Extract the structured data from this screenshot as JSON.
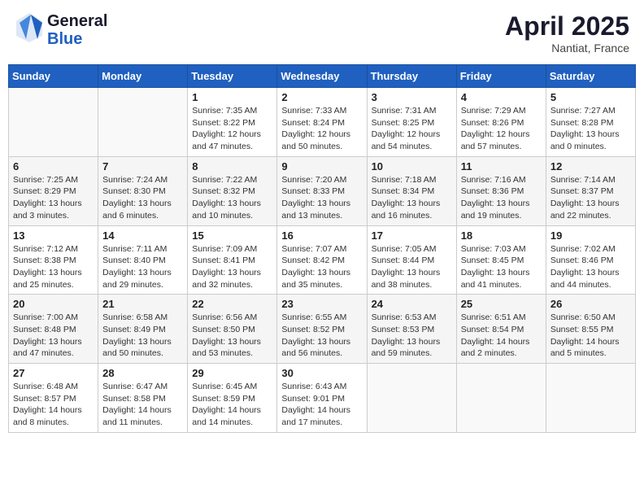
{
  "header": {
    "logo_line1": "General",
    "logo_line2": "Blue",
    "month": "April 2025",
    "location": "Nantiat, France"
  },
  "weekdays": [
    "Sunday",
    "Monday",
    "Tuesday",
    "Wednesday",
    "Thursday",
    "Friday",
    "Saturday"
  ],
  "weeks": [
    [
      {
        "day": "",
        "sunrise": "",
        "sunset": "",
        "daylight": ""
      },
      {
        "day": "",
        "sunrise": "",
        "sunset": "",
        "daylight": ""
      },
      {
        "day": "1",
        "sunrise": "Sunrise: 7:35 AM",
        "sunset": "Sunset: 8:22 PM",
        "daylight": "Daylight: 12 hours and 47 minutes."
      },
      {
        "day": "2",
        "sunrise": "Sunrise: 7:33 AM",
        "sunset": "Sunset: 8:24 PM",
        "daylight": "Daylight: 12 hours and 50 minutes."
      },
      {
        "day": "3",
        "sunrise": "Sunrise: 7:31 AM",
        "sunset": "Sunset: 8:25 PM",
        "daylight": "Daylight: 12 hours and 54 minutes."
      },
      {
        "day": "4",
        "sunrise": "Sunrise: 7:29 AM",
        "sunset": "Sunset: 8:26 PM",
        "daylight": "Daylight: 12 hours and 57 minutes."
      },
      {
        "day": "5",
        "sunrise": "Sunrise: 7:27 AM",
        "sunset": "Sunset: 8:28 PM",
        "daylight": "Daylight: 13 hours and 0 minutes."
      }
    ],
    [
      {
        "day": "6",
        "sunrise": "Sunrise: 7:25 AM",
        "sunset": "Sunset: 8:29 PM",
        "daylight": "Daylight: 13 hours and 3 minutes."
      },
      {
        "day": "7",
        "sunrise": "Sunrise: 7:24 AM",
        "sunset": "Sunset: 8:30 PM",
        "daylight": "Daylight: 13 hours and 6 minutes."
      },
      {
        "day": "8",
        "sunrise": "Sunrise: 7:22 AM",
        "sunset": "Sunset: 8:32 PM",
        "daylight": "Daylight: 13 hours and 10 minutes."
      },
      {
        "day": "9",
        "sunrise": "Sunrise: 7:20 AM",
        "sunset": "Sunset: 8:33 PM",
        "daylight": "Daylight: 13 hours and 13 minutes."
      },
      {
        "day": "10",
        "sunrise": "Sunrise: 7:18 AM",
        "sunset": "Sunset: 8:34 PM",
        "daylight": "Daylight: 13 hours and 16 minutes."
      },
      {
        "day": "11",
        "sunrise": "Sunrise: 7:16 AM",
        "sunset": "Sunset: 8:36 PM",
        "daylight": "Daylight: 13 hours and 19 minutes."
      },
      {
        "day": "12",
        "sunrise": "Sunrise: 7:14 AM",
        "sunset": "Sunset: 8:37 PM",
        "daylight": "Daylight: 13 hours and 22 minutes."
      }
    ],
    [
      {
        "day": "13",
        "sunrise": "Sunrise: 7:12 AM",
        "sunset": "Sunset: 8:38 PM",
        "daylight": "Daylight: 13 hours and 25 minutes."
      },
      {
        "day": "14",
        "sunrise": "Sunrise: 7:11 AM",
        "sunset": "Sunset: 8:40 PM",
        "daylight": "Daylight: 13 hours and 29 minutes."
      },
      {
        "day": "15",
        "sunrise": "Sunrise: 7:09 AM",
        "sunset": "Sunset: 8:41 PM",
        "daylight": "Daylight: 13 hours and 32 minutes."
      },
      {
        "day": "16",
        "sunrise": "Sunrise: 7:07 AM",
        "sunset": "Sunset: 8:42 PM",
        "daylight": "Daylight: 13 hours and 35 minutes."
      },
      {
        "day": "17",
        "sunrise": "Sunrise: 7:05 AM",
        "sunset": "Sunset: 8:44 PM",
        "daylight": "Daylight: 13 hours and 38 minutes."
      },
      {
        "day": "18",
        "sunrise": "Sunrise: 7:03 AM",
        "sunset": "Sunset: 8:45 PM",
        "daylight": "Daylight: 13 hours and 41 minutes."
      },
      {
        "day": "19",
        "sunrise": "Sunrise: 7:02 AM",
        "sunset": "Sunset: 8:46 PM",
        "daylight": "Daylight: 13 hours and 44 minutes."
      }
    ],
    [
      {
        "day": "20",
        "sunrise": "Sunrise: 7:00 AM",
        "sunset": "Sunset: 8:48 PM",
        "daylight": "Daylight: 13 hours and 47 minutes."
      },
      {
        "day": "21",
        "sunrise": "Sunrise: 6:58 AM",
        "sunset": "Sunset: 8:49 PM",
        "daylight": "Daylight: 13 hours and 50 minutes."
      },
      {
        "day": "22",
        "sunrise": "Sunrise: 6:56 AM",
        "sunset": "Sunset: 8:50 PM",
        "daylight": "Daylight: 13 hours and 53 minutes."
      },
      {
        "day": "23",
        "sunrise": "Sunrise: 6:55 AM",
        "sunset": "Sunset: 8:52 PM",
        "daylight": "Daylight: 13 hours and 56 minutes."
      },
      {
        "day": "24",
        "sunrise": "Sunrise: 6:53 AM",
        "sunset": "Sunset: 8:53 PM",
        "daylight": "Daylight: 13 hours and 59 minutes."
      },
      {
        "day": "25",
        "sunrise": "Sunrise: 6:51 AM",
        "sunset": "Sunset: 8:54 PM",
        "daylight": "Daylight: 14 hours and 2 minutes."
      },
      {
        "day": "26",
        "sunrise": "Sunrise: 6:50 AM",
        "sunset": "Sunset: 8:55 PM",
        "daylight": "Daylight: 14 hours and 5 minutes."
      }
    ],
    [
      {
        "day": "27",
        "sunrise": "Sunrise: 6:48 AM",
        "sunset": "Sunset: 8:57 PM",
        "daylight": "Daylight: 14 hours and 8 minutes."
      },
      {
        "day": "28",
        "sunrise": "Sunrise: 6:47 AM",
        "sunset": "Sunset: 8:58 PM",
        "daylight": "Daylight: 14 hours and 11 minutes."
      },
      {
        "day": "29",
        "sunrise": "Sunrise: 6:45 AM",
        "sunset": "Sunset: 8:59 PM",
        "daylight": "Daylight: 14 hours and 14 minutes."
      },
      {
        "day": "30",
        "sunrise": "Sunrise: 6:43 AM",
        "sunset": "Sunset: 9:01 PM",
        "daylight": "Daylight: 14 hours and 17 minutes."
      },
      {
        "day": "",
        "sunrise": "",
        "sunset": "",
        "daylight": ""
      },
      {
        "day": "",
        "sunrise": "",
        "sunset": "",
        "daylight": ""
      },
      {
        "day": "",
        "sunrise": "",
        "sunset": "",
        "daylight": ""
      }
    ]
  ]
}
